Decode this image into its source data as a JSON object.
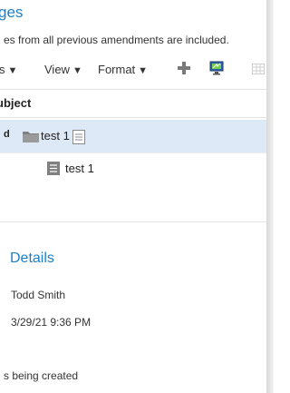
{
  "header": {
    "title": "ges",
    "note": "es from all previous amendments are included."
  },
  "toolbar": {
    "items": [
      {
        "label": "s",
        "icon": "caret-down"
      },
      {
        "label": "View",
        "icon": "caret-down"
      },
      {
        "label": "Format",
        "icon": "caret-down"
      }
    ],
    "icons": [
      "plus-icon",
      "monitor-icon",
      "grid-icon"
    ]
  },
  "table": {
    "column_header": "ubject",
    "rows": [
      {
        "toggle": "d",
        "icon": "folder-icon",
        "label": "test 1",
        "extra_icon": "document-outline-icon",
        "selected": true
      },
      {
        "icon": "document-icon",
        "label": "test 1",
        "selected": false
      }
    ]
  },
  "details": {
    "title": "Details",
    "owner": "Todd Smith",
    "date": "3/29/21 9:36 PM",
    "status": "s being created"
  },
  "colors": {
    "accent": "#1f7fc7",
    "selected_row": "#dde9f6"
  }
}
